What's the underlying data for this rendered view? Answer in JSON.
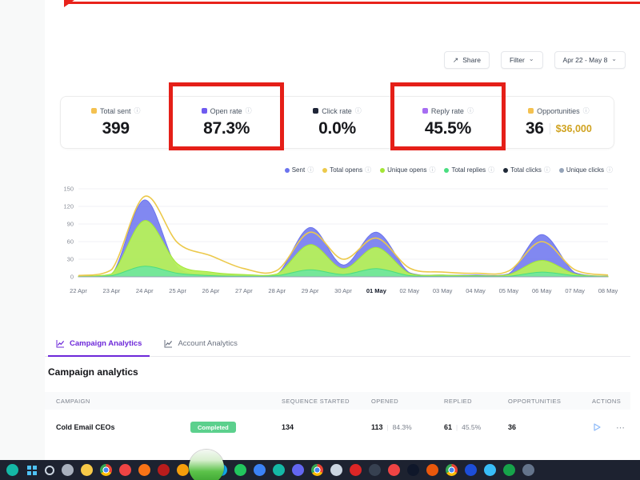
{
  "icons": {
    "info": "ⓘ",
    "chevron_down": "⌄",
    "share": "↗",
    "ellipsis": "⋯",
    "pipe": "|"
  },
  "annotations": {
    "color": "#e51f18",
    "highlighted_metrics": [
      "Open rate",
      "Reply rate"
    ]
  },
  "toolbar": {
    "share_label": "Share",
    "filter_label": "Filter",
    "date_range": "Apr 22 - May 8"
  },
  "stats": {
    "cards": [
      {
        "label": "Total sent",
        "value": "399",
        "dot_color": "#f4c150",
        "highlighted": false
      },
      {
        "label": "Open rate",
        "value": "87.3%",
        "dot_color": "#6f5bf0",
        "highlighted": true
      },
      {
        "label": "Click rate",
        "value": "0.0%",
        "dot_color": "#1e2537",
        "highlighted": false
      },
      {
        "label": "Reply rate",
        "value": "45.5%",
        "dot_color": "#a66df2",
        "highlighted": true
      },
      {
        "label": "Opportunities",
        "value": "36",
        "value_extra": "$36,000",
        "dot_color": "#f4c150",
        "highlighted": false
      }
    ]
  },
  "chart_data": {
    "type": "area",
    "title": "",
    "xlabel": "",
    "ylabel": "",
    "ylim": [
      0,
      150
    ],
    "yticks": [
      0,
      30,
      60,
      90,
      120,
      150
    ],
    "grid": true,
    "legend_position": "top-right",
    "emphasized_tick": "01 May",
    "x": [
      "22 Apr",
      "23 Apr",
      "24 Apr",
      "25 Apr",
      "26 Apr",
      "27 Apr",
      "28 Apr",
      "29 Apr",
      "30 Apr",
      "01 May",
      "02 May",
      "03 May",
      "04 May",
      "05 May",
      "06 May",
      "07 May",
      "08 May"
    ],
    "series": [
      {
        "name": "Sent",
        "color": "#6b73ee",
        "fill": true,
        "opacity": 0.85,
        "values": [
          1,
          3,
          131,
          15,
          5,
          3,
          4,
          84,
          20,
          76,
          7,
          3,
          3,
          5,
          72,
          7,
          1
        ]
      },
      {
        "name": "Total opens",
        "color": "#ecc94b",
        "fill": false,
        "values": [
          2,
          12,
          137,
          58,
          36,
          14,
          11,
          76,
          30,
          66,
          15,
          8,
          6,
          10,
          60,
          12,
          3
        ]
      },
      {
        "name": "Unique opens",
        "color": "#a3e635",
        "fill": true,
        "fill_color": "#b5f05a",
        "opacity": 0.95,
        "values": [
          1,
          5,
          96,
          22,
          8,
          4,
          5,
          55,
          14,
          50,
          6,
          3,
          2,
          4,
          28,
          5,
          1
        ]
      },
      {
        "name": "Total replies",
        "color": "#4ade80",
        "fill": true,
        "fill_color": "#6ee7a0",
        "opacity": 0.9,
        "values": [
          0,
          2,
          18,
          6,
          2,
          1,
          2,
          12,
          4,
          14,
          2,
          1,
          1,
          1,
          8,
          2,
          0
        ]
      },
      {
        "name": "Total clicks",
        "color": "#1f2937",
        "fill": false,
        "values": [
          0,
          0,
          0,
          0,
          0,
          0,
          0,
          0,
          0,
          0,
          0,
          0,
          0,
          0,
          0,
          0,
          0
        ]
      },
      {
        "name": "Unique clicks",
        "color": "#94a3b8",
        "fill": false,
        "values": [
          0,
          0,
          0,
          0,
          0,
          0,
          0,
          0,
          0,
          0,
          0,
          0,
          0,
          0,
          0,
          0,
          0
        ]
      }
    ]
  },
  "tabs": [
    {
      "label": "Campaign Analytics",
      "active": true
    },
    {
      "label": "Account Analytics",
      "active": false
    }
  ],
  "section": {
    "title": "Campaign analytics"
  },
  "table": {
    "columns": [
      "CAMPAIGN",
      "SEQUENCE STARTED",
      "OPENED",
      "REPLIED",
      "OPPORTUNITIES",
      "ACTIONS"
    ],
    "rows": [
      {
        "campaign": "Cold Email CEOs",
        "status": "Completed",
        "sequence_started": "134",
        "opened": "113",
        "opened_pct": "84.3%",
        "replied": "61",
        "replied_pct": "45.5%",
        "opportunities": "36"
      }
    ]
  },
  "taskbar": {
    "icons": [
      {
        "name": "photos",
        "color": "#14b8a6"
      },
      {
        "name": "windows-start",
        "shape": "windows"
      },
      {
        "name": "search",
        "shape": "ring"
      },
      {
        "name": "task-view",
        "color": "#a8b0bd"
      },
      {
        "name": "file-explorer",
        "color": "#f7c948"
      },
      {
        "name": "chrome",
        "shape": "chrome"
      },
      {
        "name": "gmail",
        "color": "#ef4444"
      },
      {
        "name": "firefox",
        "color": "#f97316"
      },
      {
        "name": "netflix",
        "color": "#b91c1c"
      },
      {
        "name": "vlc",
        "color": "#f59e0b"
      },
      {
        "name": "word",
        "color": "#2563eb"
      },
      {
        "name": "onedrive",
        "color": "#0ea5e9"
      },
      {
        "name": "whatsapp",
        "color": "#22c55e"
      },
      {
        "name": "zoom",
        "color": "#3b82f6"
      },
      {
        "name": "edge",
        "color": "#14b8a6"
      },
      {
        "name": "teams",
        "color": "#6366f1"
      },
      {
        "name": "chrome-profile-2",
        "shape": "chrome"
      },
      {
        "name": "camera",
        "color": "#cbd5e1"
      },
      {
        "name": "mail",
        "color": "#dc2626"
      },
      {
        "name": "obs",
        "color": "#374151"
      },
      {
        "name": "wordpress",
        "color": "#ef4444"
      },
      {
        "name": "send",
        "color": "#0f172a"
      },
      {
        "name": "brave",
        "color": "#ea580c"
      },
      {
        "name": "chrome-profile-3",
        "shape": "chrome"
      },
      {
        "name": "photoshop",
        "color": "#1d4ed8"
      },
      {
        "name": "skype",
        "color": "#38bdf8"
      },
      {
        "name": "excel",
        "color": "#16a34a"
      },
      {
        "name": "discord",
        "color": "#64748b"
      }
    ]
  }
}
